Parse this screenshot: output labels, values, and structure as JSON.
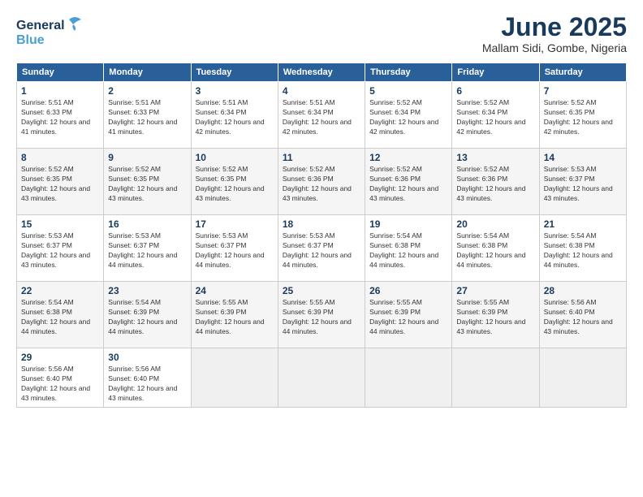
{
  "logo": {
    "line1": "General",
    "line2": "Blue"
  },
  "header": {
    "month": "June 2025",
    "location": "Mallam Sidi, Gombe, Nigeria"
  },
  "weekdays": [
    "Sunday",
    "Monday",
    "Tuesday",
    "Wednesday",
    "Thursday",
    "Friday",
    "Saturday"
  ],
  "weeks": [
    [
      {
        "day": "1",
        "sunrise": "5:51 AM",
        "sunset": "6:33 PM",
        "daylight": "12 hours and 41 minutes."
      },
      {
        "day": "2",
        "sunrise": "5:51 AM",
        "sunset": "6:33 PM",
        "daylight": "12 hours and 41 minutes."
      },
      {
        "day": "3",
        "sunrise": "5:51 AM",
        "sunset": "6:34 PM",
        "daylight": "12 hours and 42 minutes."
      },
      {
        "day": "4",
        "sunrise": "5:51 AM",
        "sunset": "6:34 PM",
        "daylight": "12 hours and 42 minutes."
      },
      {
        "day": "5",
        "sunrise": "5:52 AM",
        "sunset": "6:34 PM",
        "daylight": "12 hours and 42 minutes."
      },
      {
        "day": "6",
        "sunrise": "5:52 AM",
        "sunset": "6:34 PM",
        "daylight": "12 hours and 42 minutes."
      },
      {
        "day": "7",
        "sunrise": "5:52 AM",
        "sunset": "6:35 PM",
        "daylight": "12 hours and 42 minutes."
      }
    ],
    [
      {
        "day": "8",
        "sunrise": "5:52 AM",
        "sunset": "6:35 PM",
        "daylight": "12 hours and 43 minutes."
      },
      {
        "day": "9",
        "sunrise": "5:52 AM",
        "sunset": "6:35 PM",
        "daylight": "12 hours and 43 minutes."
      },
      {
        "day": "10",
        "sunrise": "5:52 AM",
        "sunset": "6:35 PM",
        "daylight": "12 hours and 43 minutes."
      },
      {
        "day": "11",
        "sunrise": "5:52 AM",
        "sunset": "6:36 PM",
        "daylight": "12 hours and 43 minutes."
      },
      {
        "day": "12",
        "sunrise": "5:52 AM",
        "sunset": "6:36 PM",
        "daylight": "12 hours and 43 minutes."
      },
      {
        "day": "13",
        "sunrise": "5:52 AM",
        "sunset": "6:36 PM",
        "daylight": "12 hours and 43 minutes."
      },
      {
        "day": "14",
        "sunrise": "5:53 AM",
        "sunset": "6:37 PM",
        "daylight": "12 hours and 43 minutes."
      }
    ],
    [
      {
        "day": "15",
        "sunrise": "5:53 AM",
        "sunset": "6:37 PM",
        "daylight": "12 hours and 43 minutes."
      },
      {
        "day": "16",
        "sunrise": "5:53 AM",
        "sunset": "6:37 PM",
        "daylight": "12 hours and 44 minutes."
      },
      {
        "day": "17",
        "sunrise": "5:53 AM",
        "sunset": "6:37 PM",
        "daylight": "12 hours and 44 minutes."
      },
      {
        "day": "18",
        "sunrise": "5:53 AM",
        "sunset": "6:37 PM",
        "daylight": "12 hours and 44 minutes."
      },
      {
        "day": "19",
        "sunrise": "5:54 AM",
        "sunset": "6:38 PM",
        "daylight": "12 hours and 44 minutes."
      },
      {
        "day": "20",
        "sunrise": "5:54 AM",
        "sunset": "6:38 PM",
        "daylight": "12 hours and 44 minutes."
      },
      {
        "day": "21",
        "sunrise": "5:54 AM",
        "sunset": "6:38 PM",
        "daylight": "12 hours and 44 minutes."
      }
    ],
    [
      {
        "day": "22",
        "sunrise": "5:54 AM",
        "sunset": "6:38 PM",
        "daylight": "12 hours and 44 minutes."
      },
      {
        "day": "23",
        "sunrise": "5:54 AM",
        "sunset": "6:39 PM",
        "daylight": "12 hours and 44 minutes."
      },
      {
        "day": "24",
        "sunrise": "5:55 AM",
        "sunset": "6:39 PM",
        "daylight": "12 hours and 44 minutes."
      },
      {
        "day": "25",
        "sunrise": "5:55 AM",
        "sunset": "6:39 PM",
        "daylight": "12 hours and 44 minutes."
      },
      {
        "day": "26",
        "sunrise": "5:55 AM",
        "sunset": "6:39 PM",
        "daylight": "12 hours and 44 minutes."
      },
      {
        "day": "27",
        "sunrise": "5:55 AM",
        "sunset": "6:39 PM",
        "daylight": "12 hours and 43 minutes."
      },
      {
        "day": "28",
        "sunrise": "5:56 AM",
        "sunset": "6:40 PM",
        "daylight": "12 hours and 43 minutes."
      }
    ],
    [
      {
        "day": "29",
        "sunrise": "5:56 AM",
        "sunset": "6:40 PM",
        "daylight": "12 hours and 43 minutes."
      },
      {
        "day": "30",
        "sunrise": "5:56 AM",
        "sunset": "6:40 PM",
        "daylight": "12 hours and 43 minutes."
      },
      null,
      null,
      null,
      null,
      null
    ]
  ]
}
